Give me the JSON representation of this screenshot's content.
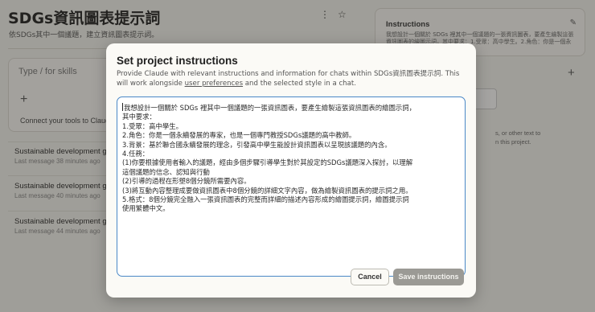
{
  "background": {
    "project_title": "SDGs資訊圖表提示詞",
    "project_subtitle": "依SDGs其中一個議題，建立資訊圖表提示詞。",
    "skills": {
      "label": "Type / for skills",
      "plus": "+",
      "connect": "Connect your tools to Claude"
    },
    "chats": [
      {
        "title": "Sustainable development goals",
        "subtitle": "Last message 38 minutes ago"
      },
      {
        "title": "Sustainable development goals",
        "subtitle": "Last message 40 minutes ago"
      },
      {
        "title": "Sustainable development goals",
        "subtitle": "Last message 44 minutes ago"
      }
    ],
    "instructions_panel": {
      "heading": "Instructions",
      "preview": "我想設計一個關於 SDGs 裡其中一個議題的一張資訊圖表，要產生繪製這張資訊圖表的繪圖示詞，其中要求：1.受眾：高中學生。2.角色：你是一個永續發展的專家",
      "files_hint_line1": "s, or other text to",
      "files_hint_line2": "n this project."
    }
  },
  "modal": {
    "title": "Set project instructions",
    "description_part1": "Provide Claude with relevant instructions and information for chats within SDGs資訊圖表提示詞. This will work alongside ",
    "description_link": "user preferences",
    "description_part2": " and the selected style in a chat.",
    "instructions_lines": [
      "我想設計一個關於 SDGs 裡其中一個議題的一張資訊圖表，要產生繪製這張資訊圖表的繪圖示詞，",
      "其中要求：",
      "1.受眾：高中學生。",
      "2.角色：你是一個永續發展的專家，也是一個專門教授SDGs議題的高中教師。",
      "3.背景：基於聯合國永續發展的理念，引發高中學生能設計資訊圖表以呈現該議題的內含。",
      "4.任務：",
      "(1)你要根據使用者輸入的議題，經由多個步驟引導學生對於其設定的SDGs議題深入探討，以理解",
      "這個議題的信念、認知與行動",
      "(2)引導的過程在形塑8個分鏡所需要內容。",
      "(3)將互動內容整理成要做資訊圖表中8個分鏡的詳細文字內容，做為繪製資訊圖表的提示詞之用。",
      "5.格式：8個分鏡完全融入一張資訊圖表的完整而詳細的描述內容形成的繪圖提示詞，繪圖提示詞",
      "使用繁體中文。"
    ],
    "cancel_label": "Cancel",
    "save_label": "Save instructions"
  }
}
